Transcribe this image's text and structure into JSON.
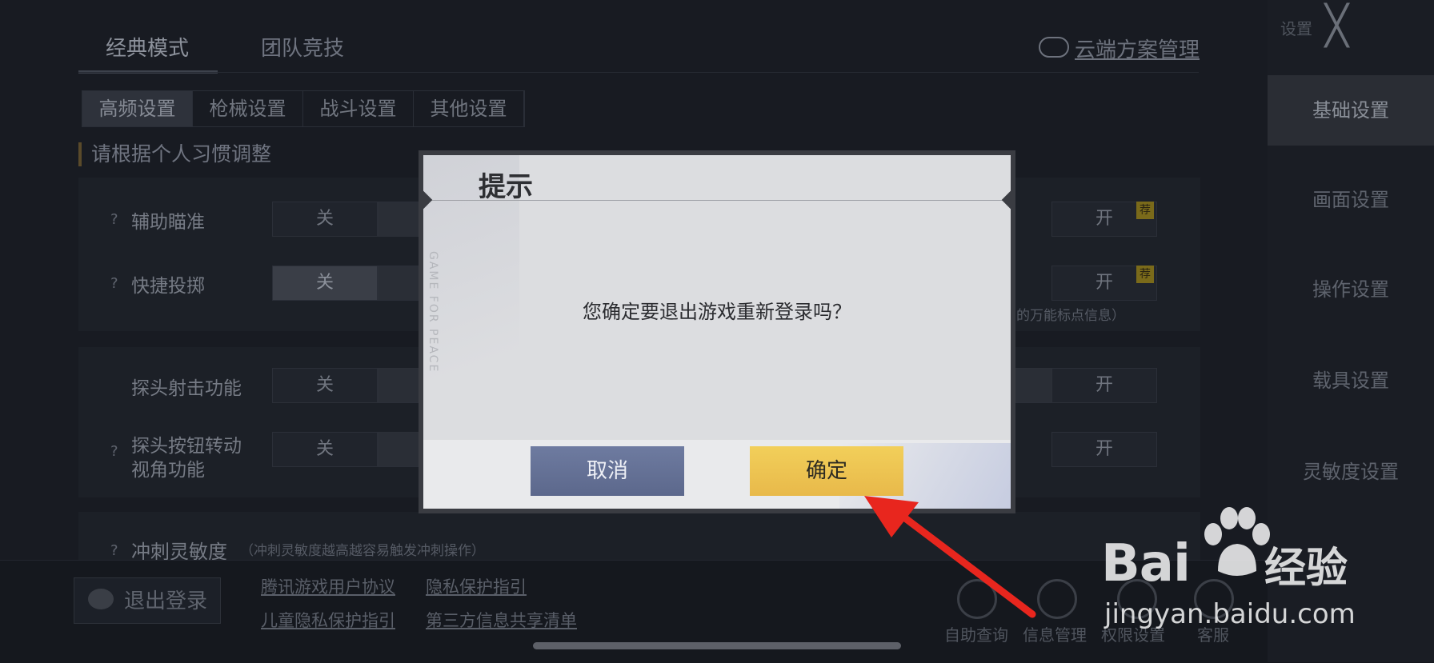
{
  "settings_page": {
    "mode_tabs": [
      "经典模式",
      "团队竞技"
    ],
    "cloud_link": "云端方案管理",
    "sub_tabs": [
      "高频设置",
      "枪械设置",
      "战斗设置",
      "其他设置"
    ],
    "hint": "请根据个人习惯调整",
    "rows": [
      {
        "label": "辅助瞄准",
        "off": "关",
        "on": "开",
        "badge": "荐"
      },
      {
        "label": "快捷投掷",
        "off": "关",
        "on": "开",
        "badge": "荐"
      },
      {
        "label": "探头射击功能",
        "off": "关",
        "on": "开"
      },
      {
        "label_line1": "探头按钮转动",
        "label_line2": "视角功能",
        "off": "关",
        "on": "开"
      }
    ],
    "quick_throw_note": "的万能标点信息）",
    "sprint_label": "冲刺灵敏度",
    "sprint_note": "（冲刺灵敏度越高越容易触发冲刺操作）",
    "question_mark": "?"
  },
  "right_nav": {
    "settings_label": "设置",
    "close_glyph": "╳",
    "items": [
      "基础设置",
      "画面设置",
      "操作设置",
      "载具设置",
      "灵敏度设置"
    ]
  },
  "bottom_bar": {
    "logout": "退出登录",
    "links": [
      "腾讯游戏用户协议",
      "隐私保护指引",
      "儿童隐私保护指引",
      "第三方信息共享清单"
    ],
    "icons": [
      "自助查询",
      "信息管理",
      "权限设置",
      "客服"
    ]
  },
  "dialog": {
    "title": "提示",
    "message": "您确定要退出游戏重新登录吗？",
    "watermark": "GAME FOR PEACE",
    "cancel": "取消",
    "confirm": "确定"
  },
  "watermark": {
    "brand_left": "Bai",
    "brand_right": "经验",
    "url": "jingyan.baidu.com"
  },
  "colors": {
    "confirm_button": "#f0c955",
    "cancel_button": "#66739a",
    "arrow": "#e8261e"
  }
}
